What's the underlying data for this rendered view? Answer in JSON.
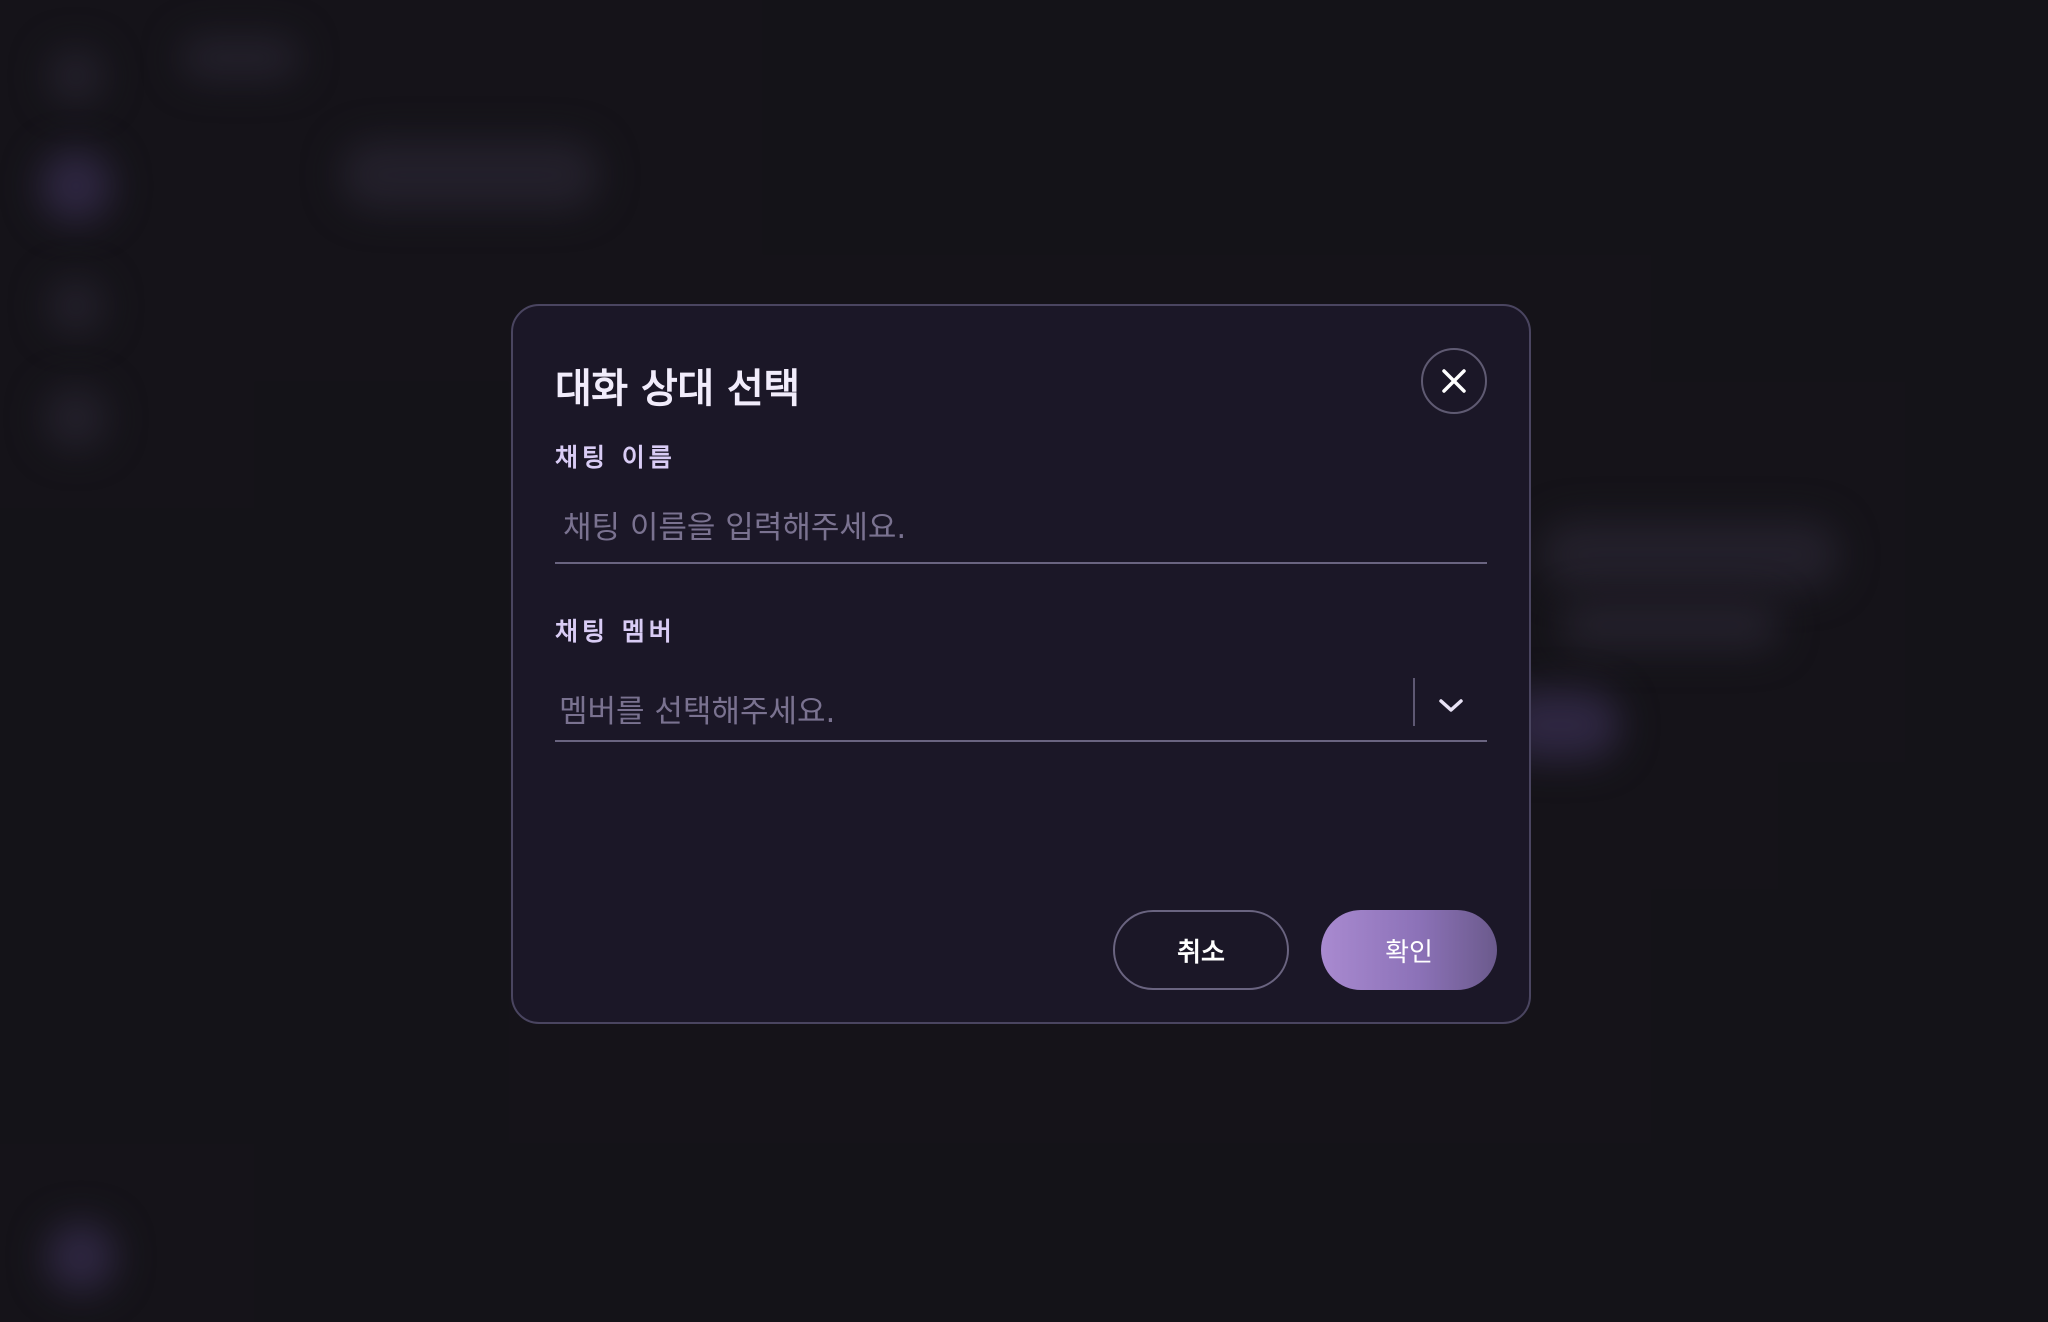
{
  "dialog": {
    "title": "대화 상대 선택",
    "close_icon": "close-icon",
    "chat_name": {
      "label": "채팅 이름",
      "value": "",
      "placeholder": "채팅 이름을 입력해주세요."
    },
    "chat_members": {
      "label": "채팅 멤버",
      "placeholder": "멤버를 선택해주세요.",
      "dropdown_icon": "chevron-down-icon"
    },
    "buttons": {
      "cancel_label": "취소",
      "confirm_label": "확인"
    }
  },
  "colors": {
    "background": "#18171c",
    "dialog_background": "#1b1727",
    "accent": "#a98ad0",
    "label": "#d9ccf5"
  }
}
